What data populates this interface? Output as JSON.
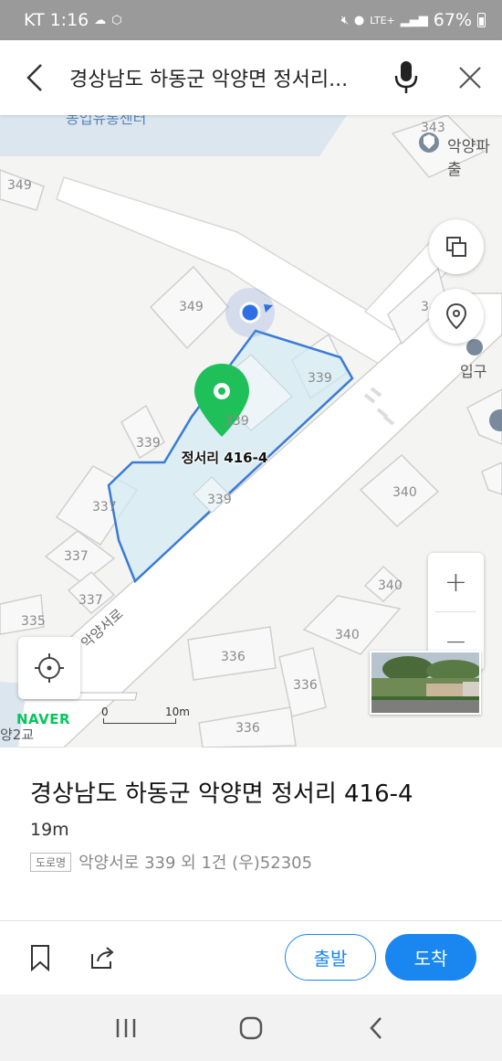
{
  "status": {
    "carrier": "KT",
    "time": "1:16",
    "network": "LTE+",
    "battery": "67%"
  },
  "search": {
    "query": "경상남도 하동군 악양면 정서리..."
  },
  "map": {
    "parcel_numbers": {
      "p343": "343",
      "p349a": "349",
      "p349b": "349",
      "p34x": "3",
      "p339a": "339",
      "p339b": "339",
      "p339c": "339",
      "p339d": "339",
      "p337a": "337",
      "p337b": "337",
      "p337c": "337",
      "p335": "335",
      "p340a": "340",
      "p340b": "340",
      "p340c": "340",
      "p336a": "336",
      "p336b": "336",
      "p336c": "336"
    },
    "poi": {
      "police": "악양파출",
      "entrance": "입구",
      "partial_top": "농업유통센터",
      "bridge": "양2교"
    },
    "road_name": "악양서로",
    "pin_label": "정서리 416-4",
    "logo": "NAVER",
    "scale_start": "0",
    "scale_end": "10m",
    "colors": {
      "pin": "#1fbf5a",
      "parcel_outline": "#3a7bd5",
      "accent": "#1a86f0"
    }
  },
  "place": {
    "title": "경상남도 하동군 악양면 정서리 416-4",
    "distance": "19m",
    "road_badge": "도로명",
    "road_address": "악양서로 339 외 1건 (우)52305"
  },
  "actions": {
    "start": "출발",
    "arrive": "도착"
  }
}
